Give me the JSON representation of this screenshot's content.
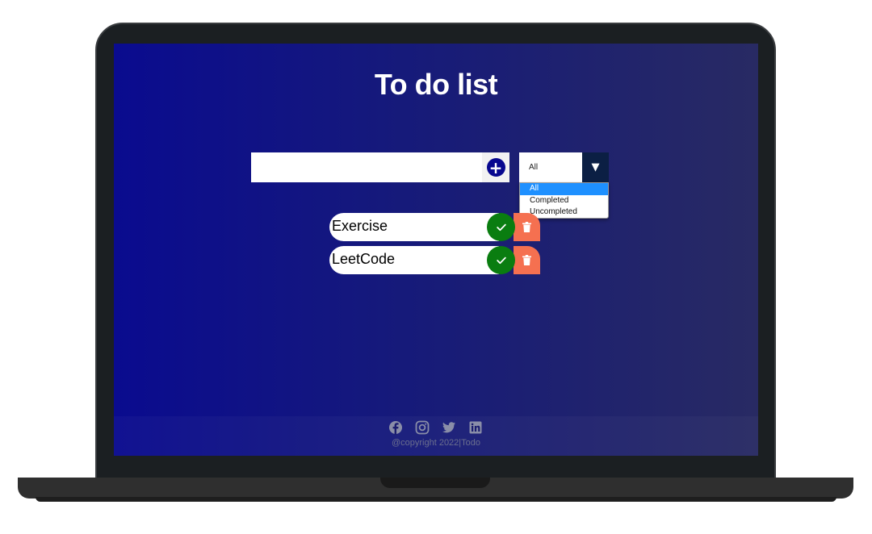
{
  "app": {
    "title": "To do list"
  },
  "input": {
    "value": "",
    "add_icon": "plus-icon"
  },
  "filter": {
    "selected": "All",
    "arrow_icon": "caret-down-icon",
    "options": [
      "All",
      "Completed",
      "Uncompleted"
    ],
    "highlighted_option": "All"
  },
  "todos": [
    {
      "text": "Exercise",
      "complete_icon": "check-icon",
      "delete_icon": "trash-icon"
    },
    {
      "text": "LeetCode",
      "complete_icon": "check-icon",
      "delete_icon": "trash-icon"
    }
  ],
  "footer": {
    "social_icons": [
      "facebook-icon",
      "instagram-icon",
      "twitter-icon",
      "linkedin-icon"
    ],
    "copyright": "@copyright 2022|Todo"
  },
  "colors": {
    "accent": "#08088f",
    "complete": "#0a7d10",
    "delete": "#f57050",
    "dropdown_highlight": "#1e90ff"
  }
}
